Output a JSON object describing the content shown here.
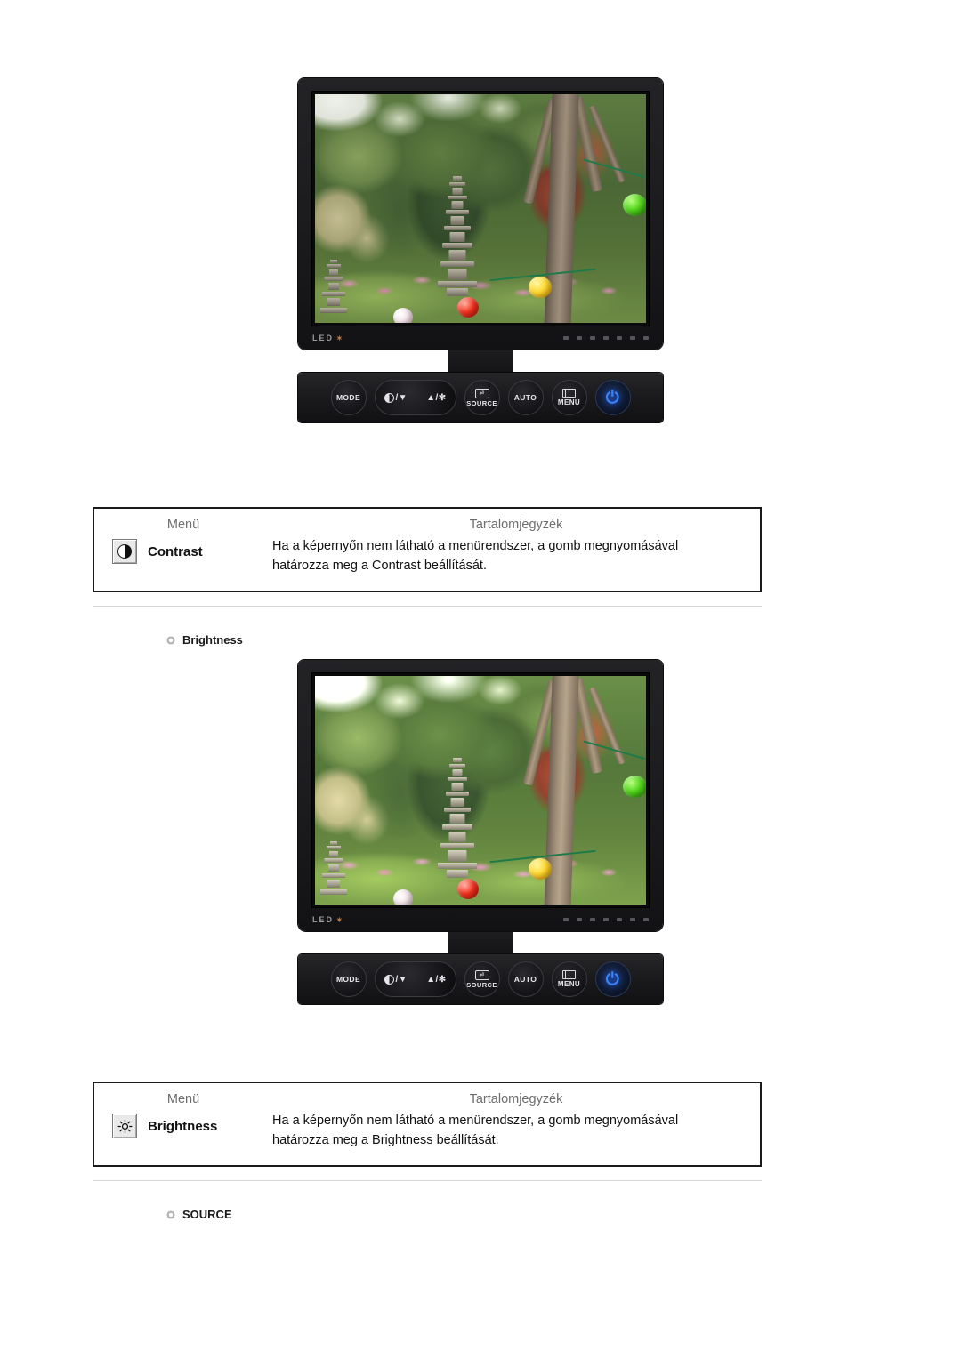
{
  "page": {
    "background": "#ffffff",
    "accent_power_blue": "#3b82f6",
    "header_text_color": "#6d6d6d"
  },
  "monitors": [
    {
      "id": "monitor-contrast",
      "screen_image": "garden-pagoda-lanterns-photo",
      "brand_mark": "LED",
      "mode": "contrast-demo"
    },
    {
      "id": "monitor-brightness",
      "screen_image": "garden-pagoda-lanterns-photo",
      "brand_mark": "LED",
      "mode": "brightness-demo"
    }
  ],
  "control_panel": {
    "buttons": [
      {
        "name": "mode-button",
        "label": "MODE",
        "icon": null
      },
      {
        "name": "contrast-down-button",
        "label": "/▼",
        "icon": "half-circle-icon"
      },
      {
        "name": "brightness-up-button",
        "label": "▲/✻",
        "icon": "sun-icon"
      },
      {
        "name": "source-button",
        "label": "SOURCE",
        "icon": "display-enter-icon"
      },
      {
        "name": "auto-button",
        "label": "AUTO",
        "icon": null
      },
      {
        "name": "menu-button",
        "label": "MENU",
        "icon": "menu-rect-icon"
      },
      {
        "name": "power-button",
        "label": "",
        "icon": "power-icon",
        "glyph": "⏻"
      }
    ]
  },
  "tables": [
    {
      "id": "contrast-table",
      "headers": {
        "menu": "Menü",
        "contents": "Tartalomjegyzék"
      },
      "row": {
        "icon": "contrast-icon",
        "label": "Contrast",
        "description": "Ha a képernyőn nem látható a menürendszer, a gomb megnyomásával határozza meg a Contrast beállítását."
      }
    },
    {
      "id": "brightness-table",
      "headers": {
        "menu": "Menü",
        "contents": "Tartalomjegyzék"
      },
      "row": {
        "icon": "brightness-icon",
        "label": "Brightness",
        "description": "Ha a képernyőn nem látható a menürendszer, a gomb megnyomásával határozza meg a Brightness beállítását."
      }
    }
  ],
  "sections": [
    {
      "id": "section-brightness",
      "bullet": "gear-bullet-icon",
      "title": "Brightness"
    },
    {
      "id": "section-source",
      "bullet": "gear-bullet-icon",
      "title": "SOURCE"
    }
  ]
}
